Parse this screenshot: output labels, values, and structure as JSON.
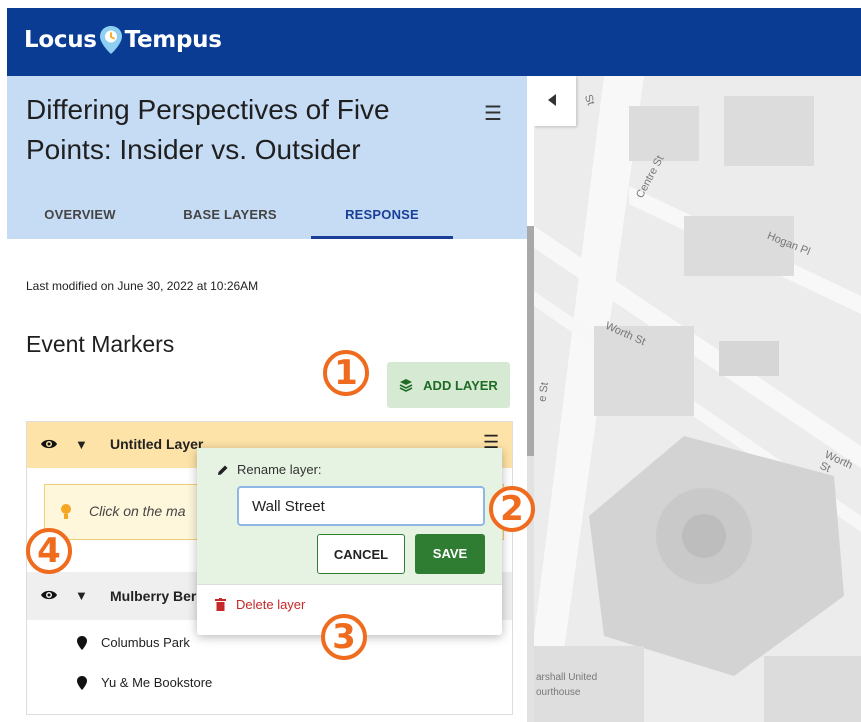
{
  "app": {
    "name_part1": "Locus",
    "name_part2": "Tempus",
    "brand_color": "#0a3c94"
  },
  "project": {
    "title": "Differing Perspectives of Five Points: Insider vs. Outsider"
  },
  "tabs": [
    {
      "label": "OVERVIEW",
      "active": false
    },
    {
      "label": "BASE LAYERS",
      "active": false
    },
    {
      "label": "RESPONSE",
      "active": true
    }
  ],
  "response": {
    "last_modified": "Last modified on June 30, 2022 at 10:26AM",
    "section_title": "Event Markers",
    "add_layer_label": "ADD LAYER"
  },
  "layer": {
    "name": "Untitled Layer",
    "hint": "Click on the ma"
  },
  "sublayer": {
    "name": "Mulberry Ber",
    "items": [
      "Columbus Park",
      "Yu & Me Bookstore"
    ]
  },
  "popup": {
    "rename_label": "Rename layer:",
    "input_value": "Wall Street",
    "cancel_label": "CANCEL",
    "save_label": "SAVE",
    "delete_label": "Delete layer"
  },
  "map": {
    "streets": [
      "St",
      "Centre St",
      "Hogan Pl",
      "Worth St",
      "e St",
      "Worth St"
    ],
    "poi_line1": "arshall United",
    "poi_line2": "ourthouse"
  },
  "callouts": [
    "1",
    "2",
    "3",
    "4"
  ],
  "colors": {
    "accent_orange": "#ef6c1f",
    "save_green": "#2e7d32",
    "delete_red": "#c62828",
    "layer_header": "#fde3a7"
  }
}
